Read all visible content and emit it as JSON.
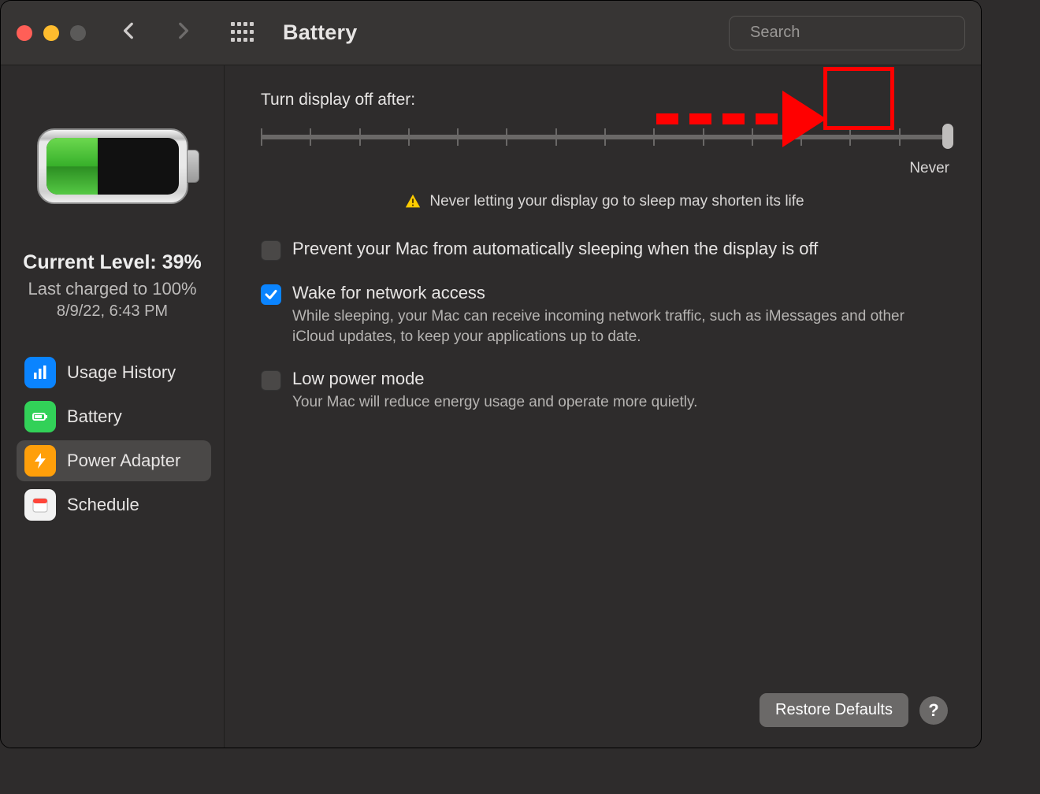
{
  "window": {
    "title": "Battery"
  },
  "search": {
    "placeholder": "Search"
  },
  "sidebar": {
    "battery_percent": 39,
    "current_level_label": "Current Level: 39%",
    "last_charged_label": "Last charged to 100%",
    "last_charged_time": "8/9/22, 6:43 PM",
    "items": [
      {
        "id": "usage-history",
        "label": "Usage History",
        "icon": "bar-chart-icon",
        "color": "blue"
      },
      {
        "id": "battery",
        "label": "Battery",
        "icon": "battery-icon",
        "color": "green"
      },
      {
        "id": "power-adapter",
        "label": "Power Adapter",
        "icon": "bolt-icon",
        "color": "orange",
        "selected": true
      },
      {
        "id": "schedule",
        "label": "Schedule",
        "icon": "calendar-icon",
        "color": "white"
      }
    ]
  },
  "main": {
    "slider": {
      "label": "Turn display off after:",
      "tick_count": 15,
      "value_index": 14,
      "end_label": "Never",
      "warning": "Never letting your display go to sleep may shorten its life"
    },
    "options": [
      {
        "id": "prevent-sleep",
        "checked": false,
        "title": "Prevent your Mac from automatically sleeping when the display is off"
      },
      {
        "id": "wake-network",
        "checked": true,
        "title": "Wake for network access",
        "desc": "While sleeping, your Mac can receive incoming network traffic, such as iMessages and other iCloud updates, to keep your applications up to date."
      },
      {
        "id": "low-power",
        "checked": false,
        "title": "Low power mode",
        "desc": "Your Mac will reduce energy usage and operate more quietly."
      }
    ],
    "footer": {
      "restore_label": "Restore Defaults",
      "help_label": "?"
    }
  },
  "annotation": {
    "type": "arrow-to-box",
    "target": "slider-thumb",
    "color": "#ff0000"
  }
}
